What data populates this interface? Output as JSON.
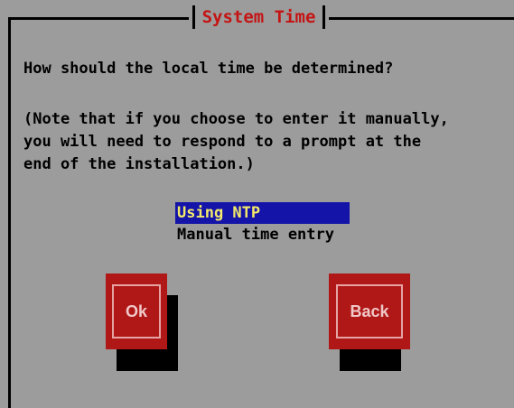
{
  "dialog": {
    "title": "System Time",
    "question": "How should the local time be determined?",
    "note": "(Note that if you choose to enter it manually,\nyou will need to respond to a prompt at the\nend of the installation.)"
  },
  "options": {
    "items": [
      "Using NTP",
      "Manual time entry"
    ],
    "selected_index": 0
  },
  "buttons": {
    "ok_label": "Ok",
    "back_label": "Back"
  },
  "colors": {
    "background": "#9c9c9c",
    "title": "#c41414",
    "selection_bg": "#1414a8",
    "selection_fg": "#f2e96b",
    "button": "#b01818"
  }
}
